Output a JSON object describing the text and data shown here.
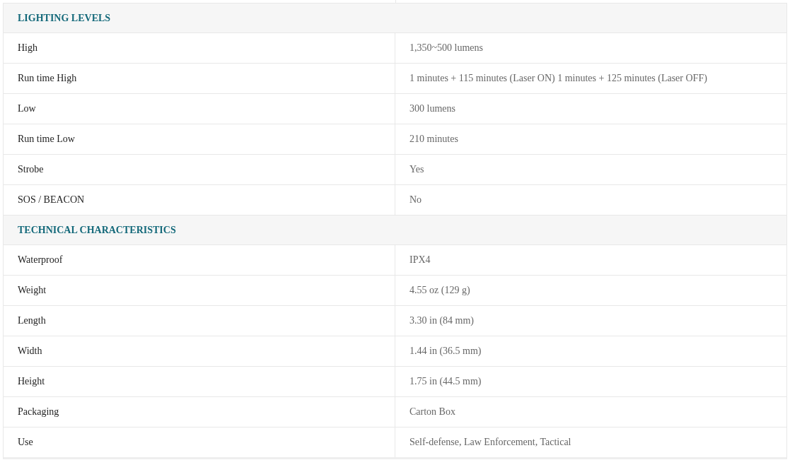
{
  "sections": [
    {
      "title": "LIGHTING LEVELS",
      "rows": [
        {
          "label": "High",
          "value": "1,350~500 lumens"
        },
        {
          "label": "Run time High",
          "value": "1 minutes + 115 minutes (Laser ON) 1 minutes + 125 minutes (Laser OFF)"
        },
        {
          "label": "Low",
          "value": "300 lumens"
        },
        {
          "label": "Run time Low",
          "value": "210 minutes"
        },
        {
          "label": "Strobe",
          "value": "Yes"
        },
        {
          "label": "SOS / BEACON",
          "value": "No"
        }
      ]
    },
    {
      "title": "TECHNICAL CHARACTERISTICS",
      "rows": [
        {
          "label": "Waterproof",
          "value": "IPX4"
        },
        {
          "label": "Weight",
          "value": "4.55 oz (129 g)"
        },
        {
          "label": "Length",
          "value": "3.30 in (84 mm)"
        },
        {
          "label": "Width",
          "value": "1.44 in (36.5 mm)"
        },
        {
          "label": "Height",
          "value": "1.75 in (44.5 mm)"
        },
        {
          "label": "Packaging",
          "value": "Carton Box"
        },
        {
          "label": "Use",
          "value": "Self-defense, Law Enforcement, Tactical"
        }
      ]
    }
  ]
}
